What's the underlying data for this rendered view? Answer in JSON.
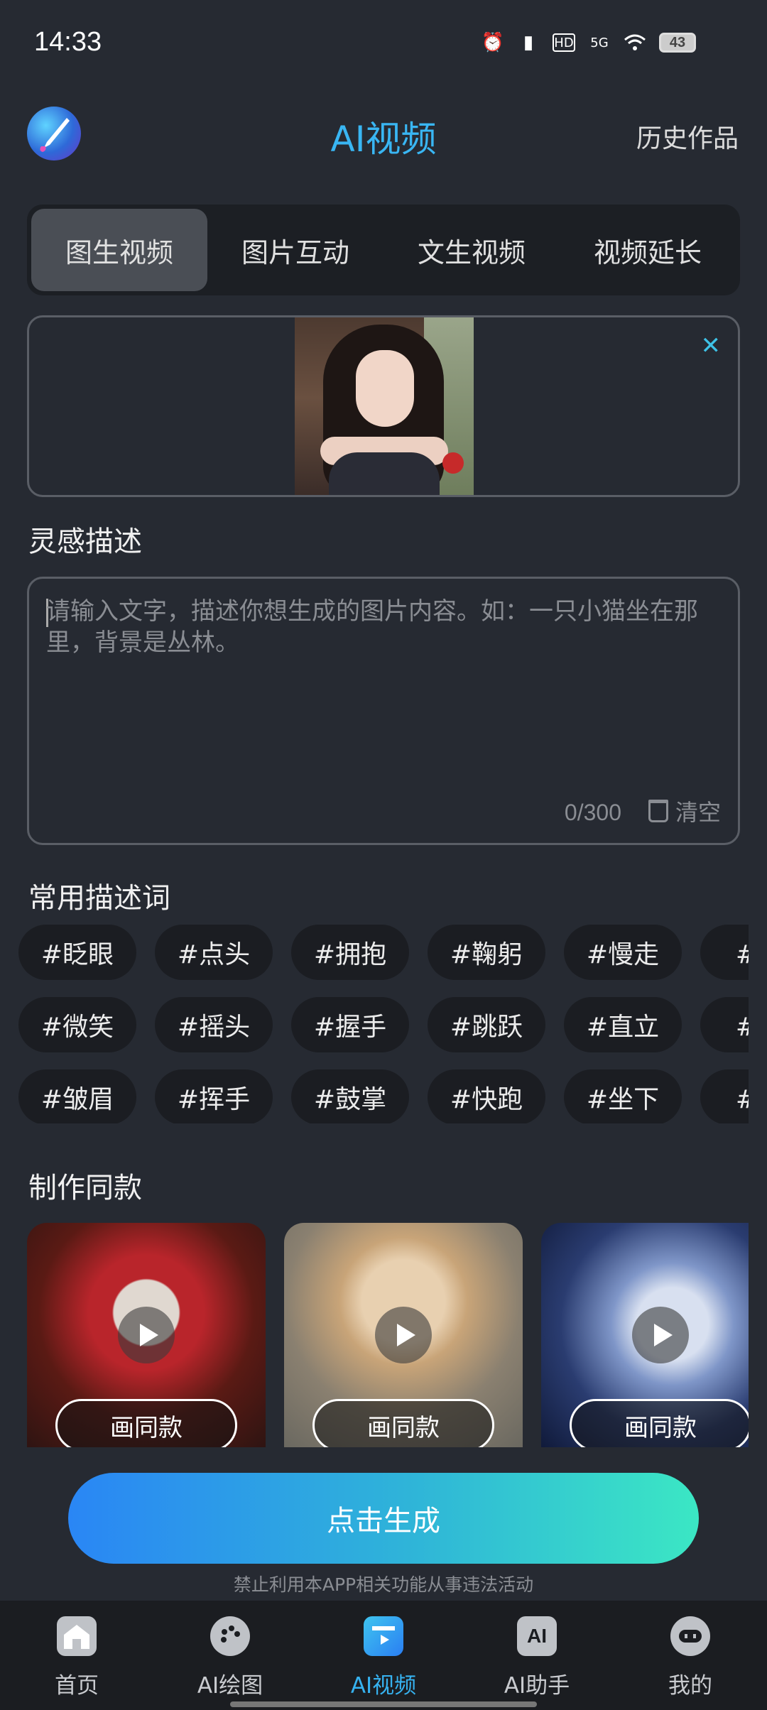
{
  "status_bar": {
    "time": "14:33",
    "battery": "43",
    "signal": "5G"
  },
  "header": {
    "title": "AI视频",
    "history_label": "历史作品"
  },
  "tabs": [
    {
      "label": "图生视频",
      "active": true
    },
    {
      "label": "图片互动",
      "active": false
    },
    {
      "label": "文生视频",
      "active": false
    },
    {
      "label": "视频延长",
      "active": false
    }
  ],
  "upload": {
    "close_icon": "close-icon",
    "image_subject": "portrait of girl"
  },
  "prompt": {
    "section_title": "灵感描述",
    "placeholder": "请输入文字，描述你想生成的图片内容。如：一只小猫坐在那里，背景是丛林。",
    "counter": "0/300",
    "clear_label": "清空"
  },
  "tags": {
    "section_title": "常用描述词",
    "rows": [
      [
        "#眨眼",
        "#点头",
        "#拥抱",
        "#鞠躬",
        "#慢走",
        "#转"
      ],
      [
        "#微笑",
        "#摇头",
        "#握手",
        "#跳跃",
        "#直立",
        "#跑"
      ],
      [
        "#皱眉",
        "#挥手",
        "#鼓掌",
        "#快跑",
        "#坐下",
        "#停"
      ]
    ]
  },
  "templates": {
    "section_title": "制作同款",
    "button_label": "画同款"
  },
  "generate": {
    "label": "点击生成",
    "notice": "禁止利用本APP相关功能从事违法活动"
  },
  "nav": [
    {
      "label": "首页",
      "icon": "home-icon",
      "active": false
    },
    {
      "label": "AI绘图",
      "icon": "palette-icon",
      "active": false
    },
    {
      "label": "AI视频",
      "icon": "video-icon",
      "active": true
    },
    {
      "label": "AI助手",
      "icon": "ai-icon",
      "active": false
    },
    {
      "label": "我的",
      "icon": "robot-icon",
      "active": false
    }
  ],
  "colors": {
    "accent": "#39b6f3",
    "background": "#262a32",
    "gradient_start": "#2a86f5",
    "gradient_end": "#3be7c4"
  }
}
